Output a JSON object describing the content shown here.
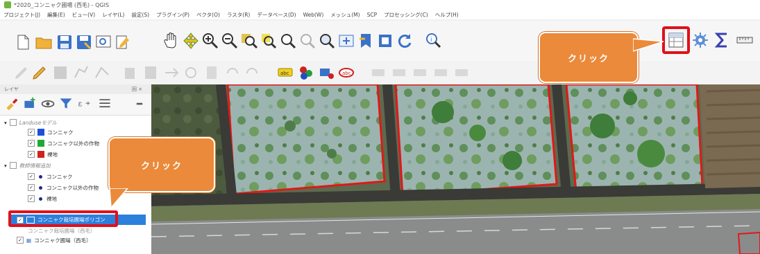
{
  "window": {
    "title": "*2020_コンニャク圃場 (西毛) - QGIS"
  },
  "menu": [
    "プロジェクト(J)",
    "編集(E)",
    "ビュー(V)",
    "レイヤ(L)",
    "設定(S)",
    "プラグイン(P)",
    "ベクタ(O)",
    "ラスタ(R)",
    "データベース(D)",
    "Web(W)",
    "メッシュ(M)",
    "SCP",
    "プロセッシング(C)",
    "ヘルプ(H)"
  ],
  "layers_panel": {
    "title": "レイヤ",
    "close_label": "回 ×",
    "rows": [
      {
        "label": "Landuseモデル",
        "type": "group",
        "checked": false
      },
      {
        "label": "コンニャク",
        "color": "#1f4fd8",
        "checked": true
      },
      {
        "label": "コンニャク以外の作物",
        "color": "#20a83a",
        "checked": true
      },
      {
        "label": "裸地",
        "color": "#d0231c",
        "checked": true
      },
      {
        "label": "教師情報追加",
        "type": "group",
        "checked": false
      },
      {
        "label": "コンニャク",
        "type": "point",
        "checked": true
      },
      {
        "label": "コンニャク以外の作物",
        "type": "point",
        "checked": true
      },
      {
        "label": "裸地",
        "type": "point",
        "checked": true
      },
      {
        "label": "コンニャク栽培圃場ポリゴン",
        "type": "polygon",
        "checked": true,
        "selected": true
      },
      {
        "label": "コンニャク栽培圃場（西毛）",
        "type": "polygon",
        "checked": false
      },
      {
        "label": "コンニャク圃場（西毛）",
        "type": "raster",
        "checked": true
      }
    ]
  },
  "callouts": {
    "toolbar": "クリック",
    "layer": "クリック"
  },
  "colors": {
    "accent": "#ea8a3a",
    "highlight": "#e0101a",
    "selection": "#2d7fdc"
  },
  "icons": [
    "new-project-icon",
    "open-folder-icon",
    "save-icon",
    "save-as-icon",
    "print-layout-icon",
    "layout-manager-icon",
    "pan-hand-icon",
    "pan-to-selection-icon",
    "zoom-in-icon",
    "zoom-out-icon",
    "zoom-full-icon",
    "zoom-to-selection-icon",
    "zoom-to-layer-icon",
    "zoom-last-icon",
    "zoom-next-icon",
    "new-map-view-icon",
    "bookmark-icon",
    "refresh-icon",
    "identify-icon",
    "attribute-table-icon",
    "settings-gear-icon",
    "statistics-sigma-icon",
    "measure-icon"
  ]
}
